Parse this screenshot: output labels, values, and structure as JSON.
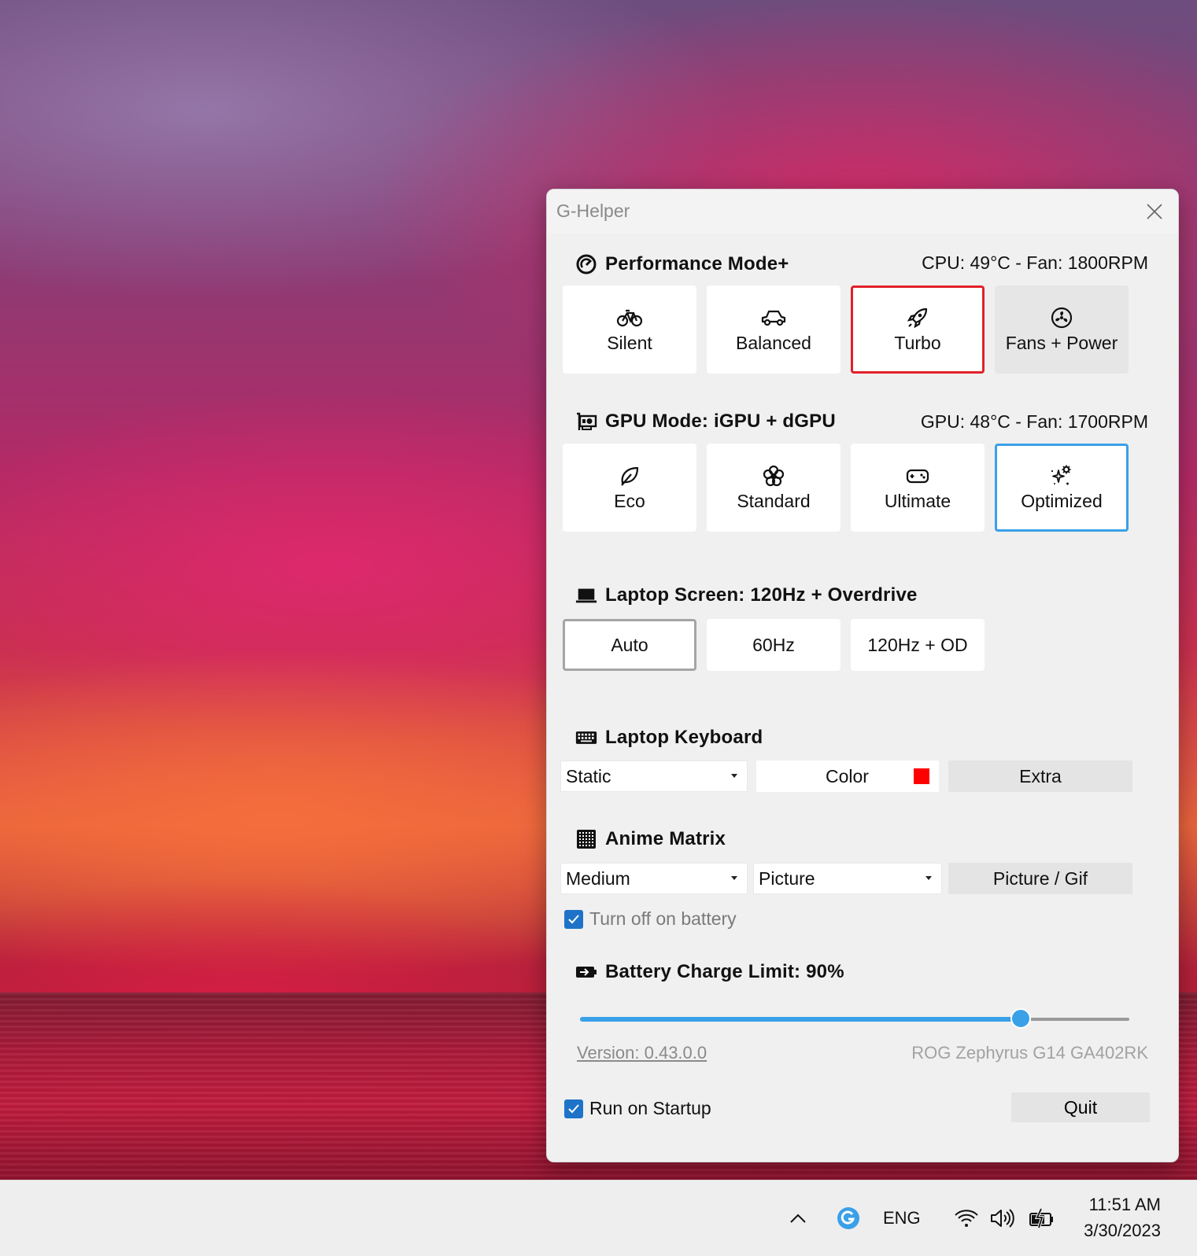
{
  "window": {
    "title": "G-Helper"
  },
  "performance": {
    "header": "Performance Mode+",
    "status": "CPU: 49°C -   Fan: 1800RPM",
    "modes": [
      {
        "label": "Silent",
        "icon": "bicycle-icon"
      },
      {
        "label": "Balanced",
        "icon": "car-icon"
      },
      {
        "label": "Turbo",
        "icon": "rocket-icon",
        "selected": true
      },
      {
        "label": "Fans + Power",
        "icon": "fan-icon"
      }
    ],
    "selected_color": "#e2202a"
  },
  "gpu": {
    "header": "GPU Mode: iGPU + dGPU",
    "status": "GPU: 48°C -   Fan: 1700RPM",
    "modes": [
      {
        "label": "Eco",
        "icon": "leaf-icon"
      },
      {
        "label": "Standard",
        "icon": "flower-icon"
      },
      {
        "label": "Ultimate",
        "icon": "gamepad-icon"
      },
      {
        "label": "Optimized",
        "icon": "sparkle-gear-icon",
        "selected": true
      }
    ],
    "selected_color": "#3aa0e8"
  },
  "screen": {
    "header": "Laptop Screen: 120Hz + Overdrive",
    "options": [
      {
        "label": "Auto",
        "selected": true
      },
      {
        "label": "60Hz"
      },
      {
        "label": "120Hz + OD"
      }
    ]
  },
  "keyboard": {
    "header": "Laptop Keyboard",
    "mode_value": "Static",
    "color_label": "Color",
    "color_value": "#ff0000",
    "extra_label": "Extra"
  },
  "anime": {
    "header": "Anime Matrix",
    "brightness_value": "Medium",
    "mode_value": "Picture",
    "picture_button": "Picture / Gif",
    "battery_checkbox_label": "Turn off on battery",
    "battery_checked": true
  },
  "battery": {
    "header": "Battery Charge Limit: 90%",
    "limit_fraction": 0.803
  },
  "footer": {
    "version": "Version: 0.43.0.0",
    "model": "ROG Zephyrus G14 GA402RK",
    "startup_label": "Run on Startup",
    "startup_checked": true,
    "quit_label": "Quit"
  },
  "taskbar": {
    "language": "ENG",
    "time": "11:51 AM",
    "date": "3/30/2023",
    "icons": [
      "chevron-up-icon",
      "ghelper-tray-icon",
      "wifi-icon",
      "volume-icon",
      "battery-charging-icon"
    ],
    "accent": "#3aa0e8"
  }
}
